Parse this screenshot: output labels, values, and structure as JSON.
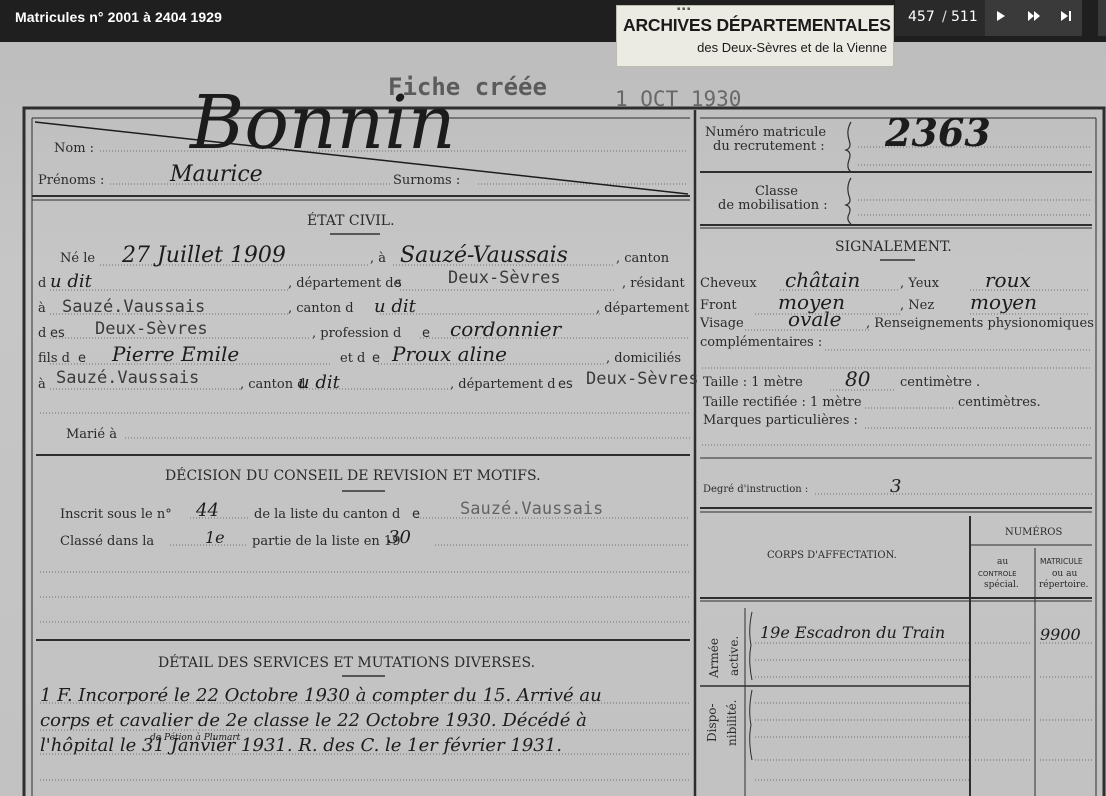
{
  "viewer": {
    "title": "Matricules n° 2001 à 2404 1929",
    "logo": {
      "line1": "ARCHIVES DÉPARTEMENTALES",
      "line2": "des Deux-Sèvres et de la Vienne"
    },
    "pager": {
      "current": "457",
      "separator": "/",
      "total": "511"
    },
    "icons": {
      "next": "play-icon",
      "fast_forward": "fast-forward-icon",
      "last": "skip-end-icon"
    }
  },
  "document": {
    "stamp_text": "Fiche   créée",
    "stamp_date": "1 OCT 1930",
    "nom_label": "Nom :",
    "nom": "Bonnin",
    "prenoms_label": "Prénoms :",
    "prenoms": "Maurice",
    "surnoms_label": "Surnoms :",
    "numero_label_1": "Numéro matricule",
    "numero_label_2": "du recrutement :",
    "numero": "2363",
    "classe_label_1": "Classe",
    "classe_label_2": "de mobilisation :",
    "etat_civil": {
      "heading": "ÉTAT CIVIL.",
      "ne_le": "Né le",
      "date_naissance": "27 Juillet 1909",
      "a": ", à",
      "lieu_naissance": "Sauzé-Vaussais",
      "canton": ", canton",
      "d": "d",
      "dit1": "u dit",
      "departement_de": ", département de",
      "es1": "s",
      "deux_sevres_1": "Deux-Sèvres",
      "residant": ", résidant",
      "a2": "à",
      "residence": "Sauzé.Vaussais",
      "canton_d": ", canton d",
      "dit2": "u dit",
      "departement": ", département",
      "d2": "d",
      "es2": "es",
      "deux_sevres_2": "Deux-Sèvres",
      "profession_de": ", profession d",
      "e1": "e",
      "profession": "cordonnier",
      "fils_de": "fils d",
      "e2": "e",
      "pere": "Pierre Emile",
      "et_de": "et d",
      "e3": "e",
      "mere": "Proux aline",
      "domicilies": ", domiciliés",
      "a3": "à",
      "domicile": "Sauzé.Vaussais",
      "canton_d2": ", canton d",
      "dit3": "u dit",
      "departement_de2": ", département d",
      "es3": "es",
      "deux_sevres_3": "Deux-Sèvres",
      "marie_a": "Marié à"
    },
    "decision": {
      "heading": "DÉCISION  DU CONSEIL DE REVISION ET MOTIFS.",
      "inscrit": "Inscrit sous le n°",
      "numero_liste": "44",
      "de_la_liste": "de la liste du canton d",
      "e": "e",
      "canton": "Sauzé.Vaussais",
      "classe_dans": "Classé dans  la",
      "partie": "1e",
      "partie_de_la_liste": "partie de la liste en 19",
      "annee": "30"
    },
    "services": {
      "heading": "DÉTAIL DES SERVICES ET MUTATIONS DIVERSES.",
      "line1": "1 F. Incorporé le 22 Octobre 1930 à compter du 15. Arrivé au",
      "line2": "corps et cavalier de 2e classe le 22 Octobre 1930. Décédé à",
      "line3": "l'hôpital  le 31 Janvier 1931. R. des C. le 1er février 1931.",
      "annotation": "de Pétion   à Plumart"
    },
    "signalement": {
      "heading": "SIGNALEMENT.",
      "cheveux": "Cheveux",
      "cheveux_val": "châtain",
      "yeux": ", Yeux",
      "yeux_val": "roux",
      "front": "Front",
      "front_val": "moyen",
      "nez": ", Nez",
      "nez_val": "moyen",
      "visage": "Visage",
      "visage_val": "ovale",
      "renseignements": ", Renseignements physionomiques",
      "complementaires": "complémentaires :",
      "taille": "Taille : 1 mètre",
      "taille_val": "80",
      "centimetre": "centimètre .",
      "taille_rectifiee": "Taille rectifiée : 1 mètre",
      "centimetres": "centimètres.",
      "marques": "Marques particulières :",
      "degre": "Degré d'instruction :",
      "degre_val": "3"
    },
    "corps": {
      "numeros": "NUMÉROS",
      "corps_affectation": "CORPS D'AFFECTATION.",
      "au": "au",
      "controle": "CONTROLE",
      "special": "spécial.",
      "matricule": "MATRICULE",
      "ou_au": "ou au",
      "repertoire": "répertoire.",
      "armee": "Armée",
      "active": "active.",
      "dispo": "Dispo-",
      "nibilite": "nibilité.",
      "affectation": "19e Escadron du Train",
      "matricule_val": "9900"
    }
  }
}
